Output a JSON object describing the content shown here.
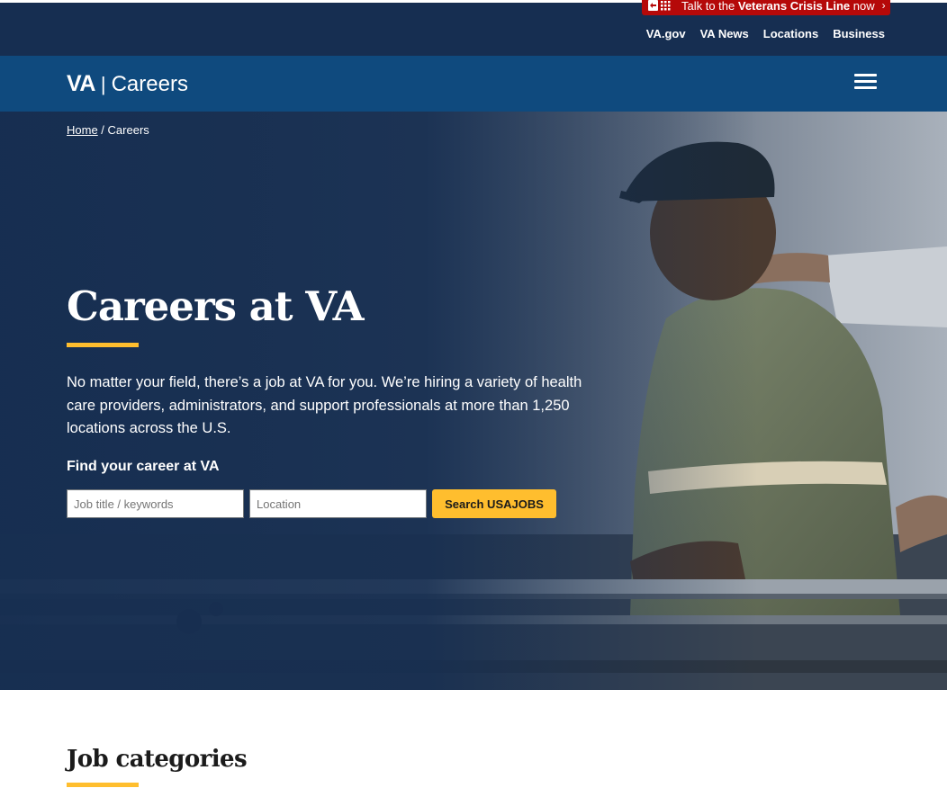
{
  "crisis_banner": {
    "prefix": "Talk to the ",
    "emphasis": "Veterans Crisis Line",
    "suffix": " now",
    "chevron": "›",
    "icon": "crisis-line-icon",
    "color": "#b50909"
  },
  "utility_nav": {
    "links": [
      "VA.gov",
      "VA News",
      "Locations",
      "Business"
    ]
  },
  "header": {
    "brand_short": "VA",
    "brand_separator": "|",
    "brand_section": "Careers",
    "menu_icon": "hamburger-menu-icon",
    "background": "#0f4a7e"
  },
  "breadcrumb": {
    "home": "Home",
    "separator": " / ",
    "current": "Careers"
  },
  "hero": {
    "title": "Careers at VA",
    "description": "No matter your field, there’s a job at VA for you. We’re hiring a variety of health care providers, administrators, and support professionals at more than 1,250 locations across the U.S.",
    "find_label": "Find your career at VA",
    "keyword_placeholder": "Job title / keywords",
    "keyword_value": "",
    "location_placeholder": "Location",
    "location_value": "",
    "search_button": "Search USAJOBS",
    "accent_color": "#ffbe2e"
  },
  "sections": {
    "job_categories_title": "Job categories"
  }
}
